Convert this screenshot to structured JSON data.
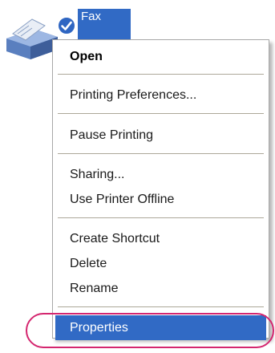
{
  "desktop_icon": {
    "name": "fax-printer",
    "label": "Fax",
    "status_icon": "check-circle-icon",
    "selection_color": "#316ac5"
  },
  "context_menu": {
    "items": [
      {
        "label": "Open",
        "bold": true
      },
      {
        "label": "Printing Preferences..."
      },
      {
        "label": "Pause Printing"
      },
      {
        "label": "Sharing..."
      },
      {
        "label": "Use Printer Offline"
      },
      {
        "label": "Create Shortcut"
      },
      {
        "label": "Delete"
      },
      {
        "label": "Rename"
      },
      {
        "label": "Properties",
        "selected": true
      }
    ],
    "highlight_color": "#316ac5",
    "callout_ring_color": "#d4266f"
  }
}
